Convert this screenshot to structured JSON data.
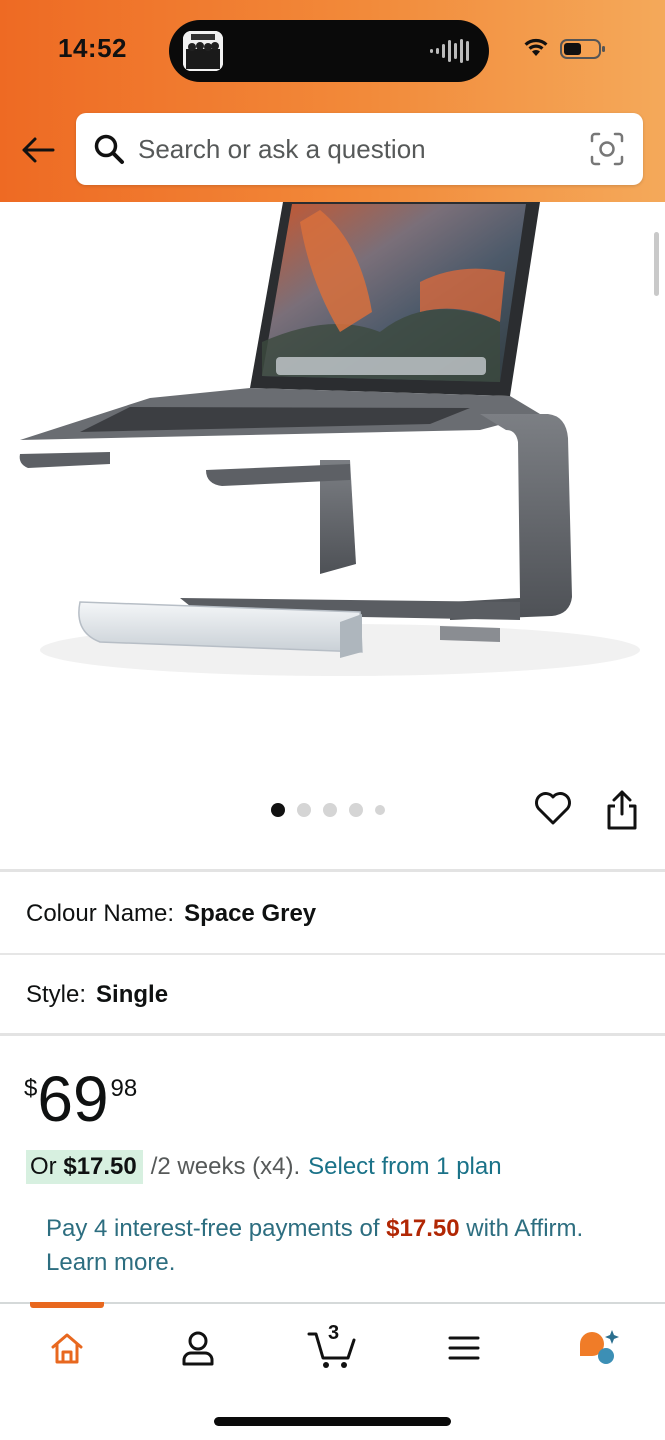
{
  "status_bar": {
    "time": "14:52"
  },
  "header": {
    "back_icon": "arrow-left-icon",
    "search": {
      "placeholder": "Search or ask a question",
      "value": "",
      "camera_icon": "lens-camera-icon"
    }
  },
  "product": {
    "image_description_icon": "laptop-stand-image",
    "carousel": {
      "total": 5,
      "active_index": 0
    },
    "actions": {
      "wishlist_icon": "heart-icon",
      "share_icon": "share-icon"
    },
    "variants": [
      {
        "label": "Colour Name:",
        "value": "Space Grey"
      },
      {
        "label": "Style:",
        "value": "Single"
      }
    ],
    "price": {
      "currency_symbol": "$",
      "whole": "69",
      "fraction": "98"
    },
    "installment": {
      "prefix": "Or",
      "amount": "$17.50",
      "period": "/2 weeks (x4).",
      "link": "Select from 1 plan"
    },
    "affirm": {
      "text_before": "Pay 4 interest-free payments of",
      "amount": "$17.50",
      "text_after": "with",
      "link": "Affirm. Learn more."
    }
  },
  "bottom_nav": {
    "items": [
      {
        "name": "home",
        "icon": "home-icon",
        "active": true
      },
      {
        "name": "account",
        "icon": "user-icon",
        "active": false
      },
      {
        "name": "cart",
        "icon": "cart-icon",
        "count": "3",
        "active": false
      },
      {
        "name": "menu",
        "icon": "menu-icon",
        "active": false
      },
      {
        "name": "rufus",
        "icon": "rufus-icon",
        "active": false
      }
    ]
  },
  "colors": {
    "header_start": "#ee6a23",
    "header_end": "#f4a95a",
    "accent": "#e8681f",
    "link": "#1a7288",
    "price_red": "#b12704",
    "deal_green_bg": "#d7f0e0"
  }
}
